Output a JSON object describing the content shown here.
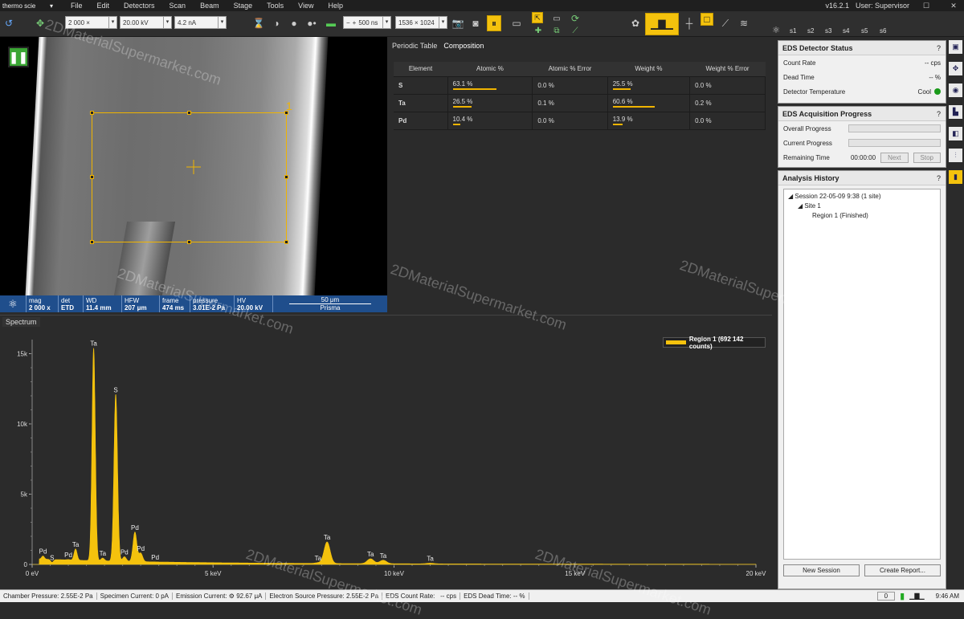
{
  "menubar": {
    "app_name": "thermo scie",
    "items": [
      "File",
      "Edit",
      "Detectors",
      "Scan",
      "Beam",
      "Stage",
      "Tools",
      "View",
      "Help"
    ],
    "version": "v16.2.1",
    "user": "User: Supervisor"
  },
  "toolbar": {
    "magnification": "2 000 ×",
    "voltage": "20.00 kV",
    "current": "4.2 nA",
    "dwell": "500 ns",
    "resolution": "1536 × 1024",
    "presets": [
      "s1",
      "s2",
      "s3",
      "s4",
      "s5",
      "s6"
    ]
  },
  "image": {
    "roi_label": "1",
    "databar": [
      {
        "label": "mag",
        "value": "2 000 x"
      },
      {
        "label": "det",
        "value": "ETD"
      },
      {
        "label": "WD",
        "value": "11.4 mm"
      },
      {
        "label": "HFW",
        "value": "207 μm"
      },
      {
        "label": "frame",
        "value": "474 ms"
      },
      {
        "label": "pressure",
        "value": "3.01E-2 Pa"
      },
      {
        "label": "HV",
        "value": "20.00 kV"
      }
    ],
    "scale_label": "50 μm",
    "scale_caption": "Prisma"
  },
  "composition": {
    "tabs": [
      "Periodic Table",
      "Composition"
    ],
    "headers": [
      "Element",
      "Atomic %",
      "Atomic % Error",
      "Weight %",
      "Weight % Error"
    ],
    "rows": [
      {
        "element": "S",
        "atomic": "63.1 %",
        "atomic_frac": 0.631,
        "atomic_err": "0.0 %",
        "weight": "25.5 %",
        "weight_frac": 0.255,
        "weight_err": "0.0 %"
      },
      {
        "element": "Ta",
        "atomic": "26.5 %",
        "atomic_frac": 0.265,
        "atomic_err": "0.1 %",
        "weight": "60.6 %",
        "weight_frac": 0.606,
        "weight_err": "0.2 %"
      },
      {
        "element": "Pd",
        "atomic": "10.4 %",
        "atomic_frac": 0.104,
        "atomic_err": "0.0 %",
        "weight": "13.9 %",
        "weight_frac": 0.139,
        "weight_err": "0.0 %"
      }
    ]
  },
  "spectrum": {
    "tab": "Spectrum",
    "legend": "Region 1 (692 142 counts)",
    "color": "#f4c20d"
  },
  "chart_data": {
    "type": "area",
    "x_ticks": [
      "0 eV",
      "5 keV",
      "10 keV",
      "15 keV",
      "20 keV"
    ],
    "y_ticks": [
      "0",
      "5k",
      "10k",
      "15k"
    ],
    "xlim": [
      0,
      20
    ],
    "ylim": [
      0,
      16000
    ],
    "peaks": [
      {
        "label": "Pd",
        "x": 0.3,
        "y": 600
      },
      {
        "label": "S",
        "x": 0.55,
        "y": 150
      },
      {
        "label": "Pd",
        "x": 1.0,
        "y": 350
      },
      {
        "label": "Ta",
        "x": 1.2,
        "y": 1100
      },
      {
        "label": "Ta",
        "x": 1.7,
        "y": 15400
      },
      {
        "label": "Ta",
        "x": 1.95,
        "y": 450
      },
      {
        "label": "S",
        "x": 2.31,
        "y": 12100
      },
      {
        "label": "Pd",
        "x": 2.55,
        "y": 550
      },
      {
        "label": "Pd",
        "x": 2.84,
        "y": 2300
      },
      {
        "label": "Pd",
        "x": 3.0,
        "y": 800
      },
      {
        "label": "Pd",
        "x": 3.4,
        "y": 180
      },
      {
        "label": "Ta",
        "x": 7.9,
        "y": 120
      },
      {
        "label": "Ta",
        "x": 8.15,
        "y": 1600
      },
      {
        "label": "Ta",
        "x": 9.35,
        "y": 400
      },
      {
        "label": "Ta",
        "x": 9.7,
        "y": 300
      },
      {
        "label": "Ta",
        "x": 11.0,
        "y": 90
      }
    ]
  },
  "eds_status": {
    "title": "EDS Detector Status",
    "help": "?",
    "rows": [
      {
        "label": "Count Rate",
        "value": "-- cps"
      },
      {
        "label": "Dead Time",
        "value": "-- %"
      },
      {
        "label": "Detector Temperature",
        "value": "Cool"
      }
    ]
  },
  "eds_progress": {
    "title": "EDS Acquisition Progress",
    "help": "?",
    "overall": "Overall Progress",
    "current": "Current Progress",
    "remaining_label": "Remaining Time",
    "remaining_value": "00:00:00",
    "next": "Next",
    "stop": "Stop"
  },
  "history": {
    "title": "Analysis History",
    "help": "?",
    "session": "Session 22-05-09 9:38 (1 site)",
    "site": "Site 1",
    "region": "Region 1 (Finished)",
    "new_session": "New Session",
    "create_report": "Create Report..."
  },
  "status": {
    "chamber": "Chamber Pressure: 2.55E-2 Pa",
    "specimen": "Specimen Current: 0 pA",
    "emission_label": "Emission Current:",
    "emission_value": "92.67 μA",
    "source": "Electron Source Pressure: 2.55E-2 Pa",
    "eds_count_label": "EDS Count Rate:",
    "eds_count_value": "-- cps",
    "eds_dead": "EDS Dead Time: -- %",
    "counter": "0",
    "time": "9:46 AM"
  },
  "watermark": "2DMaterialSupermarket.com"
}
